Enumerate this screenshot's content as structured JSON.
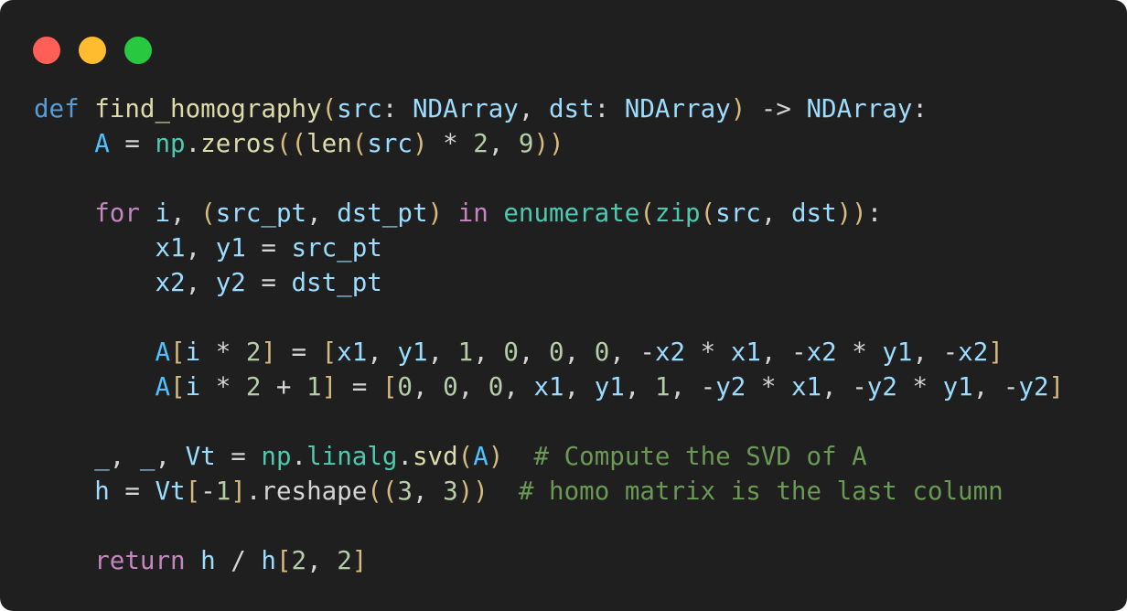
{
  "window": {
    "controls": [
      {
        "name": "close",
        "color": "#ff5f57"
      },
      {
        "name": "minimize",
        "color": "#febc2e"
      },
      {
        "name": "maximize",
        "color": "#28c840"
      }
    ]
  },
  "code": {
    "language": "python",
    "lines": [
      [
        {
          "t": "def",
          "c": "kw-def"
        },
        {
          "t": " ",
          "c": "op"
        },
        {
          "t": "find_homography",
          "c": "fn"
        },
        {
          "t": "(",
          "c": "bracket"
        },
        {
          "t": "src",
          "c": "param"
        },
        {
          "t": ": ",
          "c": "op"
        },
        {
          "t": "NDArray",
          "c": "type"
        },
        {
          "t": ", ",
          "c": "op"
        },
        {
          "t": "dst",
          "c": "param"
        },
        {
          "t": ": ",
          "c": "op"
        },
        {
          "t": "NDArray",
          "c": "type"
        },
        {
          "t": ")",
          "c": "bracket"
        },
        {
          "t": " -> ",
          "c": "op"
        },
        {
          "t": "NDArray",
          "c": "type"
        },
        {
          "t": ":",
          "c": "op"
        }
      ],
      [
        {
          "t": "    ",
          "c": "op"
        },
        {
          "t": "A",
          "c": "var-const"
        },
        {
          "t": " = ",
          "c": "op"
        },
        {
          "t": "np",
          "c": "mod"
        },
        {
          "t": ".",
          "c": "op"
        },
        {
          "t": "zeros",
          "c": "fn"
        },
        {
          "t": "((",
          "c": "bracket"
        },
        {
          "t": "len",
          "c": "fn"
        },
        {
          "t": "(",
          "c": "bracket"
        },
        {
          "t": "src",
          "c": "var"
        },
        {
          "t": ")",
          "c": "bracket"
        },
        {
          "t": " * ",
          "c": "op"
        },
        {
          "t": "2",
          "c": "num"
        },
        {
          "t": ", ",
          "c": "op"
        },
        {
          "t": "9",
          "c": "num"
        },
        {
          "t": "))",
          "c": "bracket"
        }
      ],
      [],
      [
        {
          "t": "    ",
          "c": "op"
        },
        {
          "t": "for",
          "c": "kw-flow"
        },
        {
          "t": " ",
          "c": "op"
        },
        {
          "t": "i",
          "c": "var"
        },
        {
          "t": ", ",
          "c": "op"
        },
        {
          "t": "(",
          "c": "bracket"
        },
        {
          "t": "src_pt",
          "c": "var"
        },
        {
          "t": ", ",
          "c": "op"
        },
        {
          "t": "dst_pt",
          "c": "var"
        },
        {
          "t": ")",
          "c": "bracket"
        },
        {
          "t": " ",
          "c": "op"
        },
        {
          "t": "in",
          "c": "kw-flow"
        },
        {
          "t": " ",
          "c": "op"
        },
        {
          "t": "enumerate",
          "c": "builtin"
        },
        {
          "t": "(",
          "c": "bracket"
        },
        {
          "t": "zip",
          "c": "builtin"
        },
        {
          "t": "(",
          "c": "bracket"
        },
        {
          "t": "src",
          "c": "var"
        },
        {
          "t": ", ",
          "c": "op"
        },
        {
          "t": "dst",
          "c": "var"
        },
        {
          "t": "))",
          "c": "bracket"
        },
        {
          "t": ":",
          "c": "op"
        }
      ],
      [
        {
          "t": "        ",
          "c": "op"
        },
        {
          "t": "x1",
          "c": "var"
        },
        {
          "t": ", ",
          "c": "op"
        },
        {
          "t": "y1",
          "c": "var"
        },
        {
          "t": " = ",
          "c": "op"
        },
        {
          "t": "src_pt",
          "c": "var"
        }
      ],
      [
        {
          "t": "        ",
          "c": "op"
        },
        {
          "t": "x2",
          "c": "var"
        },
        {
          "t": ", ",
          "c": "op"
        },
        {
          "t": "y2",
          "c": "var"
        },
        {
          "t": " = ",
          "c": "op"
        },
        {
          "t": "dst_pt",
          "c": "var"
        }
      ],
      [],
      [
        {
          "t": "        ",
          "c": "op"
        },
        {
          "t": "A",
          "c": "var-const"
        },
        {
          "t": "[",
          "c": "bracket"
        },
        {
          "t": "i",
          "c": "var"
        },
        {
          "t": " * ",
          "c": "op"
        },
        {
          "t": "2",
          "c": "num"
        },
        {
          "t": "]",
          "c": "bracket"
        },
        {
          "t": " = ",
          "c": "op"
        },
        {
          "t": "[",
          "c": "bracket"
        },
        {
          "t": "x1",
          "c": "var"
        },
        {
          "t": ", ",
          "c": "op"
        },
        {
          "t": "y1",
          "c": "var"
        },
        {
          "t": ", ",
          "c": "op"
        },
        {
          "t": "1",
          "c": "num"
        },
        {
          "t": ", ",
          "c": "op"
        },
        {
          "t": "0",
          "c": "num"
        },
        {
          "t": ", ",
          "c": "op"
        },
        {
          "t": "0",
          "c": "num"
        },
        {
          "t": ", ",
          "c": "op"
        },
        {
          "t": "0",
          "c": "num"
        },
        {
          "t": ", -",
          "c": "op"
        },
        {
          "t": "x2",
          "c": "var"
        },
        {
          "t": " * ",
          "c": "op"
        },
        {
          "t": "x1",
          "c": "var"
        },
        {
          "t": ", -",
          "c": "op"
        },
        {
          "t": "x2",
          "c": "var"
        },
        {
          "t": " * ",
          "c": "op"
        },
        {
          "t": "y1",
          "c": "var"
        },
        {
          "t": ", -",
          "c": "op"
        },
        {
          "t": "x2",
          "c": "var"
        },
        {
          "t": "]",
          "c": "bracket"
        }
      ],
      [
        {
          "t": "        ",
          "c": "op"
        },
        {
          "t": "A",
          "c": "var-const"
        },
        {
          "t": "[",
          "c": "bracket"
        },
        {
          "t": "i",
          "c": "var"
        },
        {
          "t": " * ",
          "c": "op"
        },
        {
          "t": "2",
          "c": "num"
        },
        {
          "t": " + ",
          "c": "op"
        },
        {
          "t": "1",
          "c": "num"
        },
        {
          "t": "]",
          "c": "bracket"
        },
        {
          "t": " = ",
          "c": "op"
        },
        {
          "t": "[",
          "c": "bracket"
        },
        {
          "t": "0",
          "c": "num"
        },
        {
          "t": ", ",
          "c": "op"
        },
        {
          "t": "0",
          "c": "num"
        },
        {
          "t": ", ",
          "c": "op"
        },
        {
          "t": "0",
          "c": "num"
        },
        {
          "t": ", ",
          "c": "op"
        },
        {
          "t": "x1",
          "c": "var"
        },
        {
          "t": ", ",
          "c": "op"
        },
        {
          "t": "y1",
          "c": "var"
        },
        {
          "t": ", ",
          "c": "op"
        },
        {
          "t": "1",
          "c": "num"
        },
        {
          "t": ", -",
          "c": "op"
        },
        {
          "t": "y2",
          "c": "var"
        },
        {
          "t": " * ",
          "c": "op"
        },
        {
          "t": "x1",
          "c": "var"
        },
        {
          "t": ", -",
          "c": "op"
        },
        {
          "t": "y2",
          "c": "var"
        },
        {
          "t": " * ",
          "c": "op"
        },
        {
          "t": "y1",
          "c": "var"
        },
        {
          "t": ", -",
          "c": "op"
        },
        {
          "t": "y2",
          "c": "var"
        },
        {
          "t": "]",
          "c": "bracket"
        }
      ],
      [],
      [
        {
          "t": "    ",
          "c": "op"
        },
        {
          "t": "_",
          "c": "var"
        },
        {
          "t": ", ",
          "c": "op"
        },
        {
          "t": "_",
          "c": "var"
        },
        {
          "t": ", ",
          "c": "op"
        },
        {
          "t": "Vt",
          "c": "var"
        },
        {
          "t": " = ",
          "c": "op"
        },
        {
          "t": "np",
          "c": "mod"
        },
        {
          "t": ".",
          "c": "op"
        },
        {
          "t": "linalg",
          "c": "mod"
        },
        {
          "t": ".",
          "c": "op"
        },
        {
          "t": "svd",
          "c": "fn"
        },
        {
          "t": "(",
          "c": "bracket"
        },
        {
          "t": "A",
          "c": "var-const"
        },
        {
          "t": ")",
          "c": "bracket"
        },
        {
          "t": "  ",
          "c": "op"
        },
        {
          "t": "# Compute the SVD of A",
          "c": "comment"
        }
      ],
      [
        {
          "t": "    ",
          "c": "op"
        },
        {
          "t": "h",
          "c": "var"
        },
        {
          "t": " = ",
          "c": "op"
        },
        {
          "t": "Vt",
          "c": "var"
        },
        {
          "t": "[",
          "c": "bracket"
        },
        {
          "t": "-",
          "c": "op"
        },
        {
          "t": "1",
          "c": "num"
        },
        {
          "t": "]",
          "c": "bracket"
        },
        {
          "t": ".reshape",
          "c": "op"
        },
        {
          "t": "((",
          "c": "bracket"
        },
        {
          "t": "3",
          "c": "num"
        },
        {
          "t": ", ",
          "c": "op"
        },
        {
          "t": "3",
          "c": "num"
        },
        {
          "t": "))",
          "c": "bracket"
        },
        {
          "t": "  ",
          "c": "op"
        },
        {
          "t": "# homo matrix is the last column",
          "c": "comment"
        }
      ],
      [],
      [
        {
          "t": "    ",
          "c": "op"
        },
        {
          "t": "return",
          "c": "kw-flow"
        },
        {
          "t": " ",
          "c": "op"
        },
        {
          "t": "h",
          "c": "var"
        },
        {
          "t": " / ",
          "c": "op"
        },
        {
          "t": "h",
          "c": "var"
        },
        {
          "t": "[",
          "c": "bracket"
        },
        {
          "t": "2",
          "c": "num"
        },
        {
          "t": ", ",
          "c": "op"
        },
        {
          "t": "2",
          "c": "num"
        },
        {
          "t": "]",
          "c": "bracket"
        }
      ]
    ]
  }
}
